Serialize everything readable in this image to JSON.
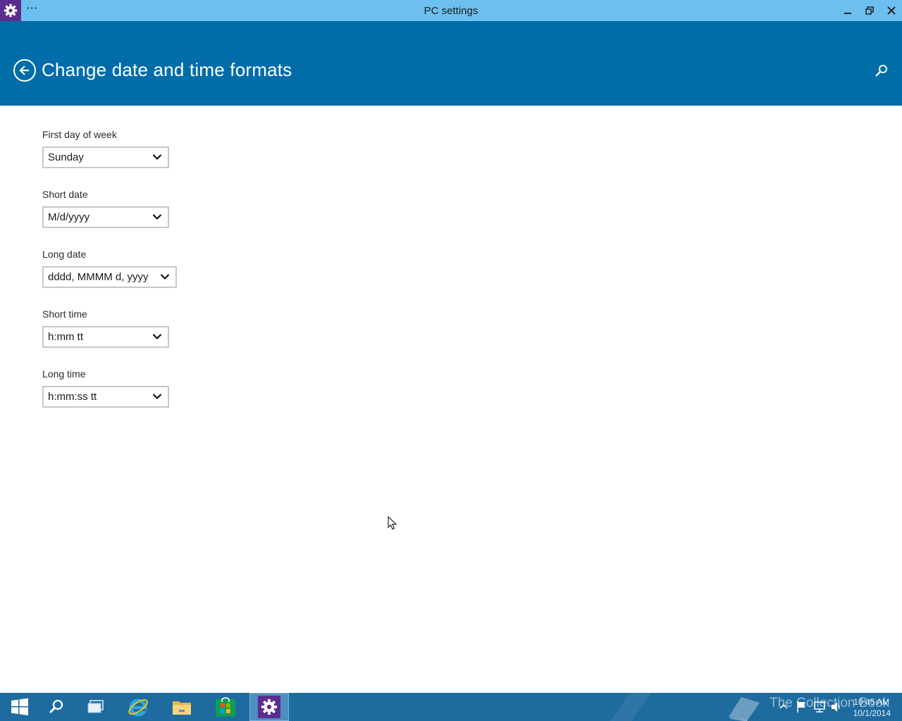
{
  "window": {
    "title": "PC settings",
    "menu_label": "···",
    "icon": "gear-icon",
    "controls": [
      "minimize-icon",
      "restore-icon",
      "close-icon"
    ]
  },
  "header": {
    "title": "Change date and time formats",
    "back_icon": "back-arrow-icon",
    "search_icon": "search-icon",
    "background": "#006ca8"
  },
  "settings": {
    "first_day_of_week": {
      "label": "First day of week",
      "value": "Sunday"
    },
    "short_date": {
      "label": "Short date",
      "value": "M/d/yyyy"
    },
    "long_date": {
      "label": "Long date",
      "value": "dddd, MMMM d, yyyy"
    },
    "short_time": {
      "label": "Short time",
      "value": "h:mm tt"
    },
    "long_time": {
      "label": "Long time",
      "value": "h:mm:ss tt"
    }
  },
  "taskbar": {
    "items": [
      "windows-start-icon",
      "search-icon",
      "task-view-icon",
      "internet-explorer-icon",
      "file-explorer-icon",
      "store-icon",
      "settings-icon"
    ],
    "active_item": "settings-icon",
    "watermark": "The Collection Book",
    "time": "10:45 AM",
    "date": "10/1/2014",
    "tray_icons": [
      "show-hidden-icons-icon",
      "action-center-flag-icon",
      "network-icon",
      "volume-icon"
    ]
  },
  "colors": {
    "titlebar": "#6cbfef",
    "header": "#006ca8",
    "taskbar": "#1e6ba0",
    "accent_purple": "#5b2d90"
  }
}
